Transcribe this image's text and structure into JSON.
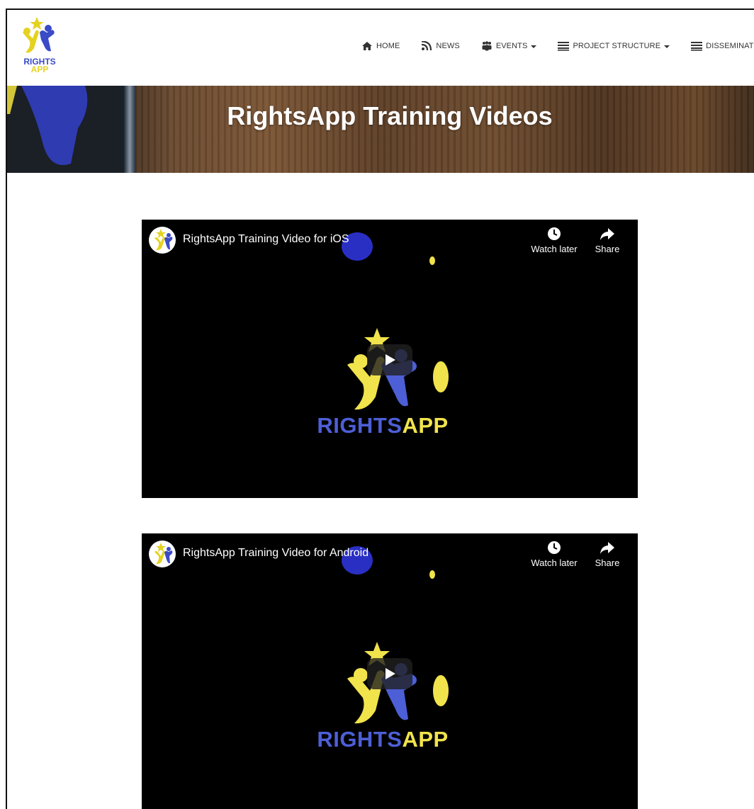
{
  "site": {
    "logo_line1": "RIGHTS",
    "logo_line2": "APP",
    "colors": {
      "brand_blue": "#3a4bc7",
      "brand_yellow": "#e5d21f"
    }
  },
  "nav": {
    "items": [
      {
        "label": "HOME",
        "icon": "home-icon",
        "dropdown": false
      },
      {
        "label": "NEWS",
        "icon": "rss-icon",
        "dropdown": false
      },
      {
        "label": "EVENTS",
        "icon": "people-icon",
        "dropdown": true
      },
      {
        "label": "PROJECT STRUCTURE",
        "icon": "list-icon",
        "dropdown": true
      },
      {
        "label": "DISSEMINATION",
        "icon": "list-icon",
        "dropdown": true
      }
    ]
  },
  "hero": {
    "title": "RightsApp Training Videos"
  },
  "videos": [
    {
      "title": "RightsApp Training Video for iOS",
      "watch_later": "Watch later",
      "share": "Share",
      "brand_part1": "RIGHTS",
      "brand_part2": "APP"
    },
    {
      "title": "RightsApp Training Video for Android",
      "watch_later": "Watch later",
      "share": "Share",
      "brand_part1": "RIGHTS",
      "brand_part2": "APP"
    }
  ]
}
